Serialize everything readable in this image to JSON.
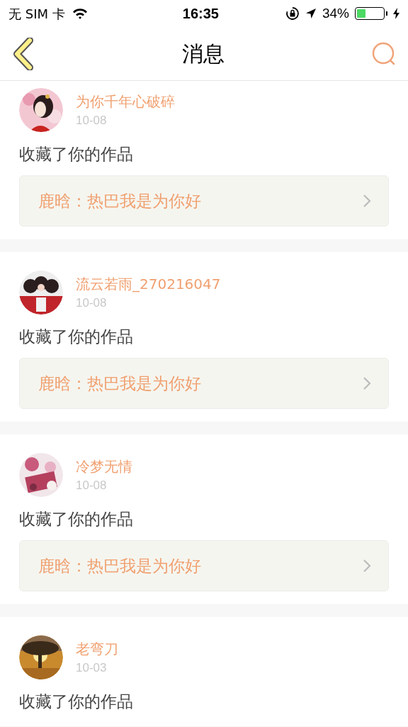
{
  "status_bar": {
    "carrier": "无 SIM 卡",
    "time": "16:35",
    "battery": "34%"
  },
  "nav": {
    "title": "消息"
  },
  "messages": [
    {
      "user": "为你千年心破碎",
      "date": "10-08",
      "action": "收藏了你的作品",
      "work": "鹿晗：热巴我是为你好"
    },
    {
      "user": "流云若雨_270216047",
      "date": "10-08",
      "action": "收藏了你的作品",
      "work": "鹿晗：热巴我是为你好"
    },
    {
      "user": "冷梦无情",
      "date": "10-08",
      "action": "收藏了你的作品",
      "work": "鹿晗：热巴我是为你好"
    },
    {
      "user": "老弯刀",
      "date": "10-03",
      "action": "收藏了你的作品"
    }
  ]
}
